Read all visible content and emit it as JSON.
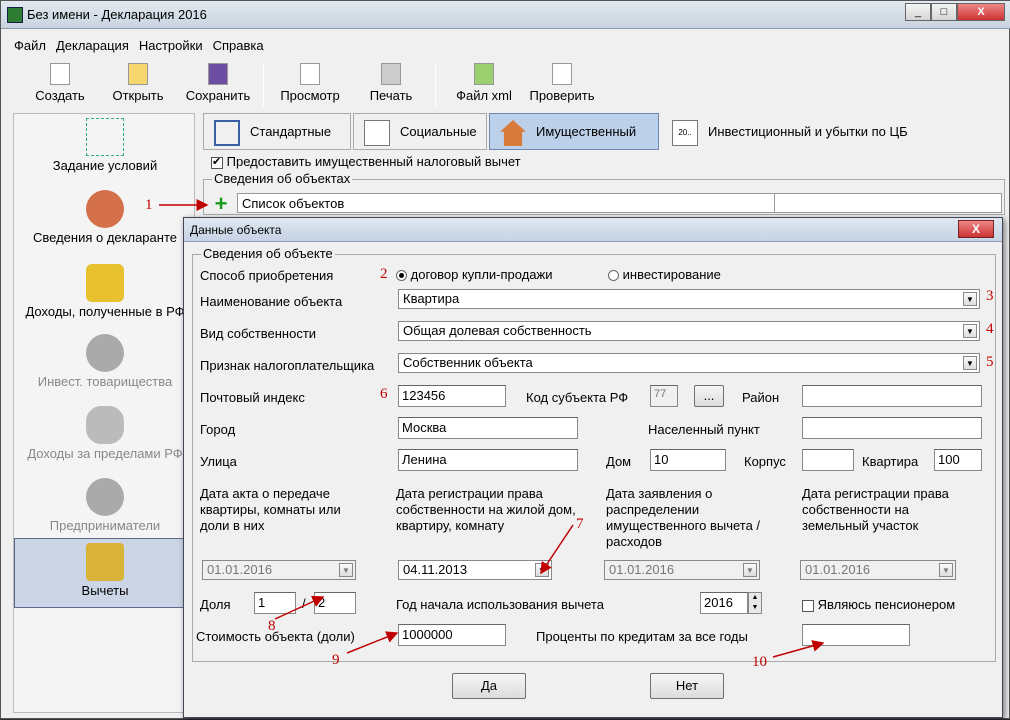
{
  "window": {
    "title": "Без имени - Декларация 2016",
    "min": "_",
    "max": "□",
    "close": "X"
  },
  "menu": [
    "Файл",
    "Декларация",
    "Настройки",
    "Справка"
  ],
  "toolbar": {
    "create": "Создать",
    "open": "Открыть",
    "save": "Сохранить",
    "preview": "Просмотр",
    "print": "Печать",
    "xml": "Файл xml",
    "check": "Проверить"
  },
  "nav": [
    "Задание условий",
    "Сведения о декларанте",
    "Доходы, полученные в РФ",
    "Инвест. товарищества",
    "Доходы за пределами РФ",
    "Предприниматели",
    "Вычеты"
  ],
  "tabs": [
    "Стандартные",
    "Социальные",
    "Имущественный",
    "Инвестиционный и убытки по ЦБ"
  ],
  "tab_icon_text": "20..",
  "checkbox_property": "Предоставить имущественный налоговый вычет",
  "objects_group": "Сведения об объектах",
  "objects_list_header": "Список объектов",
  "add_icon": "+",
  "dialog": {
    "title": "Данные объекта",
    "close": "X",
    "group": "Сведения об объекте",
    "acq_label": "Способ приобретения",
    "acq_opt1": "договор купли-продажи",
    "acq_opt2": "инвестирование",
    "name_label": "Наименование объекта",
    "name_value": "Квартира",
    "own_label": "Вид собственности",
    "own_value": "Общая долевая собственность",
    "payer_label": "Признак налогоплательщика",
    "payer_value": "Собственник объекта",
    "zip_label": "Почтовый индекс",
    "zip_value": "123456",
    "region_label": "Код субъекта РФ",
    "region_value": "77",
    "region_btn": "...",
    "district_label": "Район",
    "district_value": "",
    "city_label": "Город",
    "city_value": "Москва",
    "locality_label": "Населенный пункт",
    "locality_value": "",
    "street_label": "Улица",
    "street_value": "Ленина",
    "house_label": "Дом",
    "house_value": "10",
    "block_label": "Корпус",
    "block_value": "",
    "flat_label": "Квартира",
    "flat_value": "100",
    "date1_label": "Дата акта о передаче квартиры, комнаты или доли в них",
    "date1_value": "01.01.2016",
    "date2_label": "Дата регистрации права собственности на жилой дом, квартиру, комнату",
    "date2_value": "04.11.2013",
    "date3_label": "Дата заявления о распределении имущественного вычета / расходов",
    "date3_value": "01.01.2016",
    "date4_label": "Дата регистрации права собственности на земельный участок",
    "date4_value": "01.01.2016",
    "share_label": "Доля",
    "share_num": "1",
    "share_sep": "/",
    "share_den": "2",
    "year_label": "Год начала использования вычета",
    "year_value": "2016",
    "pensioner_label": "Являюсь пенсионером",
    "cost_label": "Стоимость объекта (доли)",
    "cost_value": "1000000",
    "interest_label": "Проценты по кредитам за все годы",
    "interest_value": "",
    "ok": "Да",
    "cancel": "Нет"
  },
  "annotations": [
    "1",
    "2",
    "3",
    "4",
    "5",
    "6",
    "7",
    "8",
    "9",
    "10"
  ],
  "colors": {
    "annotation": "#c00000",
    "selected_tab": "#bdd0ea",
    "selected_nav": "#cbd5e6"
  }
}
